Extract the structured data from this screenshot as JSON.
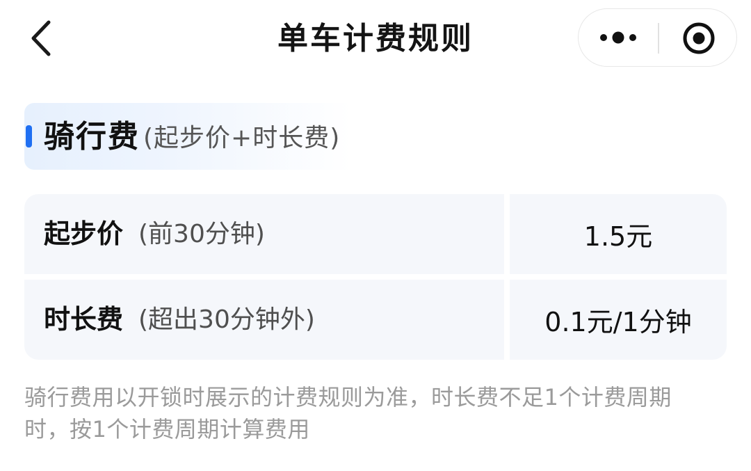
{
  "nav": {
    "title": "单车计费规则",
    "back_icon": "chevron-left-icon",
    "more_icon": "more-dots-icon",
    "close_icon": "record-target-icon"
  },
  "section": {
    "title": "骑行费",
    "subtitle": "(起步价+时长费)",
    "accent_color": "#1f6ff2"
  },
  "price_table": {
    "rows": [
      {
        "name": "起步价",
        "note": "(前30分钟)",
        "price": "1.5元"
      },
      {
        "name": "时长费",
        "note": "(超出30分钟外)",
        "price": "0.1元/1分钟"
      }
    ]
  },
  "footnote": {
    "line1": "骑行费用以开锁时展示的计费规则为准，时长费不足1个计费周期",
    "line2": "时，按1个计费周期计算费用"
  }
}
